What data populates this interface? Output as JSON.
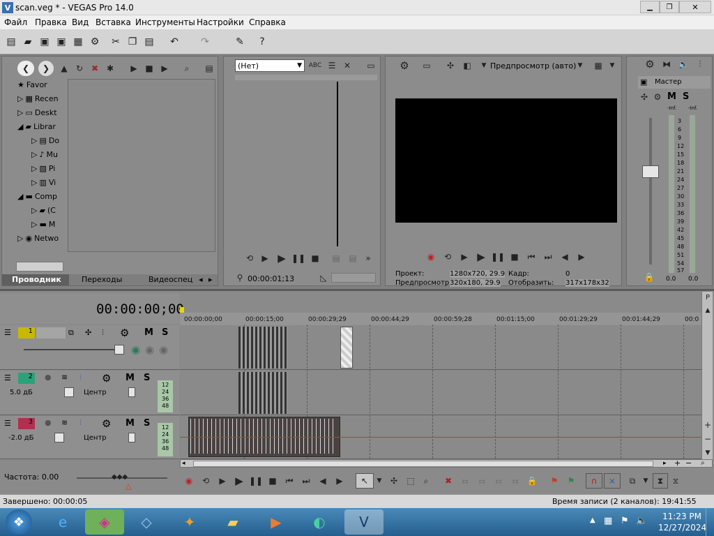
{
  "window": {
    "title": "scan.veg * - VEGAS Pro 14.0",
    "app_icon": "vegas-logo-icon"
  },
  "menu": [
    "Файл",
    "Правка",
    "Вид",
    "Вставка",
    "Инструменты",
    "Настройки",
    "Справка"
  ],
  "explorer": {
    "tree": [
      "Favor",
      "Recen",
      "Deskt",
      "Librar",
      "Do",
      "Mu",
      "Pi",
      "Vi",
      "Comp",
      "(C",
      "M",
      "Netwo"
    ],
    "tabs": [
      "Проводник",
      "Переходы",
      "Видеоспецэ"
    ]
  },
  "trimmer": {
    "dropdown": "(Нет)",
    "timecode": "00:00:01;13"
  },
  "preview": {
    "mode": "Предпросмотр (авто)",
    "project_label": "Проект:",
    "project_value": "1280x720, 29.9",
    "preview_label": "Предпросмотр:",
    "preview_value": "320x180, 29.9",
    "frame_label": "Кадр:",
    "frame_value": "0",
    "display_label": "Отобразить:",
    "display_value": "317x178x32"
  },
  "master": {
    "label": "Мастер",
    "scale": [
      "3",
      "6",
      "9",
      "12",
      "15",
      "18",
      "21",
      "24",
      "27",
      "30",
      "33",
      "36",
      "39",
      "42",
      "45",
      "48",
      "51",
      "54",
      "57"
    ],
    "top_left": "-Inf.",
    "top_right": "-Inf.",
    "bottom_left": "0.0",
    "bottom_right": "0.0"
  },
  "timeline": {
    "timecode": "00:00:00;00",
    "ruler": [
      "00:00:00;00",
      "00:00:15;00",
      "00:00:29;29",
      "00:00:44;29",
      "00:00:59;28",
      "00:01:15;00",
      "00:01:29;29",
      "00:01:44;29",
      "00:0"
    ]
  },
  "tracks": [
    {
      "num": "1",
      "color": "#c9b800",
      "m": "M",
      "s": "S"
    },
    {
      "num": "2",
      "color": "#2aa27a",
      "m": "M",
      "s": "S",
      "vol": "5.0 дБ",
      "pan": "Центр",
      "meter": [
        "12",
        "24",
        "36",
        "48"
      ]
    },
    {
      "num": "3",
      "color": "#b03050",
      "m": "M",
      "s": "S",
      "vol": "-2.0 дБ",
      "pan": "Центр",
      "meter": [
        "12",
        "24",
        "36",
        "48"
      ]
    }
  ],
  "rate": "Частота: 0.00",
  "status": {
    "left": "Завершено: 00:00:05",
    "right": "Время записи (2 каналов): 19:41:55"
  },
  "clock": {
    "time": "11:23 PM",
    "date": "12/27/2024"
  }
}
